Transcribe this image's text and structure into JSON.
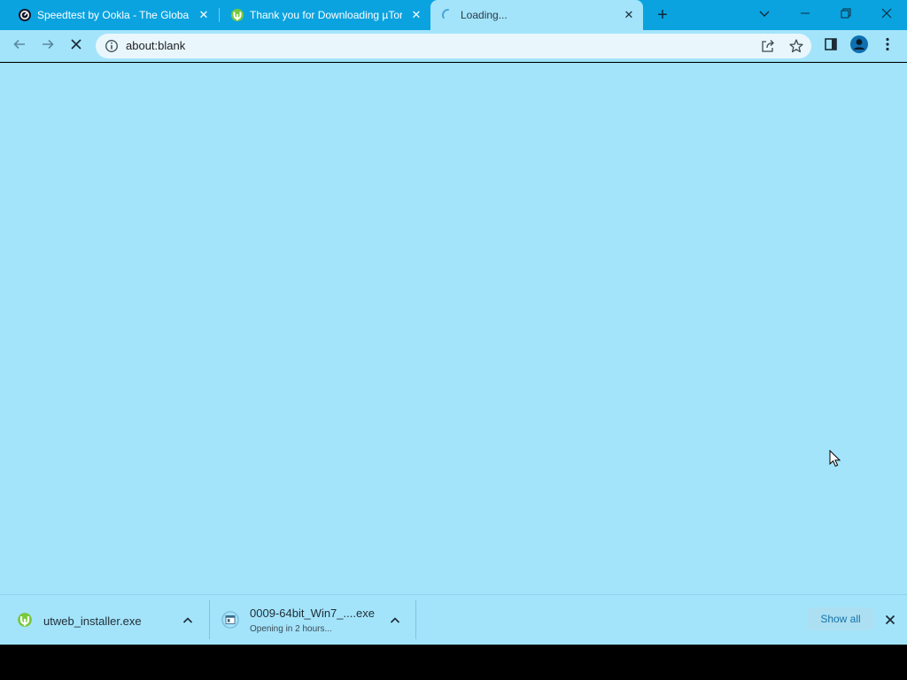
{
  "tabs": [
    {
      "title": "Speedtest by Ookla - The Global",
      "icon": "speedtest-icon",
      "close": "✕"
    },
    {
      "title": "Thank you for Downloading µTorrent",
      "icon": "utorrent-icon",
      "close": "✕"
    },
    {
      "title": "Loading...",
      "icon": "loading-spinner-icon",
      "close": "✕",
      "active": true
    }
  ],
  "titlebar": {
    "new_tab": "+",
    "tab_search": "chevron-down-icon"
  },
  "window_controls": [
    "minimize-icon",
    "restore-icon",
    "close-icon"
  ],
  "toolbar": {
    "url": "about:blank",
    "back": "back-arrow-icon",
    "forward": "forward-arrow-icon",
    "stop": "stop-loading-icon"
  },
  "downloads": [
    {
      "name": "utweb_installer.exe",
      "status": "",
      "icon": "utorrent-icon"
    },
    {
      "name": "0009-64bit_Win7_....exe",
      "status": "Opening in 2 hours...",
      "icon": "installer-file-icon"
    }
  ],
  "download_bar": {
    "show_all": "Show all"
  },
  "colors": {
    "titlebar": "#0aa3e0",
    "toolbar": "#a3e4fb",
    "omnibox": "#e9f7fd",
    "link": "#1673a8"
  }
}
